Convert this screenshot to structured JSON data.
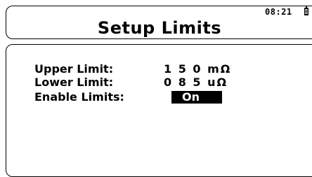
{
  "header": {
    "time": "08:21",
    "battery_icon": "battery-icon",
    "title": "Setup Limits"
  },
  "limits": {
    "upper": {
      "label": "Upper Limit:",
      "value": "1 5 0 mΩ"
    },
    "lower": {
      "label": "Lower Limit:",
      "value": "0 8 5 uΩ"
    },
    "enable": {
      "label": "Enable Limits:",
      "value": "On"
    }
  }
}
